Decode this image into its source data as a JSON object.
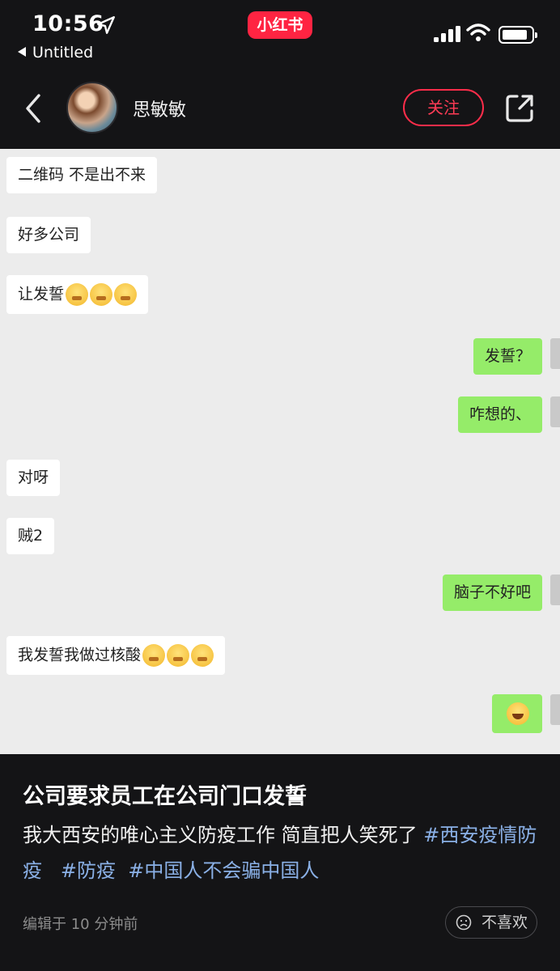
{
  "status_bar": {
    "time": "10:56",
    "back_app": "Untitled",
    "brand": "小红书"
  },
  "header": {
    "username": "思敏敏",
    "follow_label": "关注"
  },
  "chat": {
    "messages": [
      {
        "side": "left",
        "text": "二维码  不是出不来"
      },
      {
        "side": "left",
        "text": "好多公司"
      },
      {
        "side": "left",
        "text": "让发誓"
      },
      {
        "side": "right",
        "text": "发誓？"
      },
      {
        "side": "right",
        "text": "咋想的、"
      },
      {
        "side": "left",
        "text": "对呀"
      },
      {
        "side": "left",
        "text": "贼2"
      },
      {
        "side": "right",
        "text": "脑子不好吧"
      },
      {
        "side": "left",
        "text": "我发誓我做过核酸"
      },
      {
        "side": "right",
        "text": ""
      }
    ]
  },
  "caption": {
    "title": "公司要求员工在公司门口发誓",
    "description": "我大西安的唯心主义防疫工作 简直把人笑死了 ",
    "tags": [
      "#西安疫情防疫",
      "#防疫",
      "#中国人不会骗中国人"
    ],
    "edited": "编辑于 10 分钟前",
    "dislike_label": "不喜欢"
  },
  "colors": {
    "accent": "#ff2442",
    "tag": "#8ab0e6",
    "chat_right_bubble": "#95ec69"
  }
}
